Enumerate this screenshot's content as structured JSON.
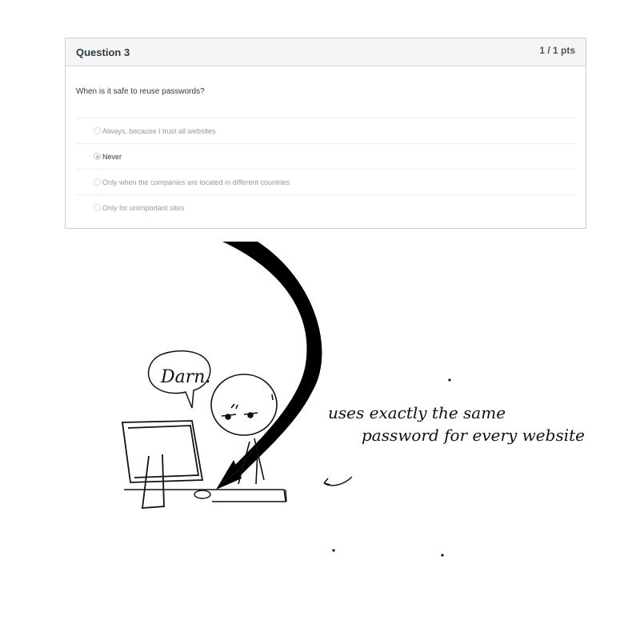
{
  "quiz": {
    "title": "Question 3",
    "points": "1 / 1 pts",
    "question": "When is it safe to reuse passwords?",
    "answers": [
      {
        "label": "Always, because I trust all websites",
        "selected": false
      },
      {
        "label": "Never",
        "selected": true
      },
      {
        "label": "Only when the companies are located in different countries",
        "selected": false
      },
      {
        "label": "Only for unimportant sites",
        "selected": false
      }
    ]
  },
  "comic": {
    "speech": "Darn.",
    "caption_line1": "uses exactly the same",
    "caption_line2": "password for every website"
  }
}
